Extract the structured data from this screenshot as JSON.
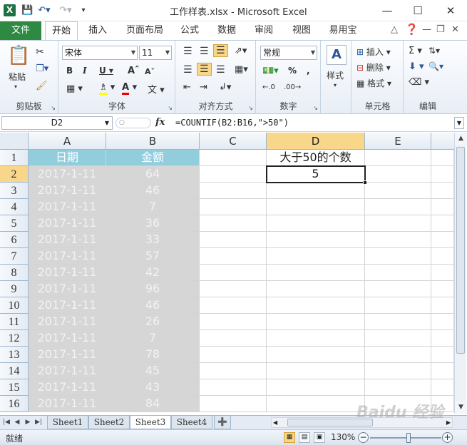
{
  "window": {
    "title": "工作样表.xlsx - Microsoft Excel",
    "logo": "X"
  },
  "ribbon": {
    "file_tab": "文件",
    "tabs": [
      "开始",
      "插入",
      "页面布局",
      "公式",
      "数据",
      "审阅",
      "视图",
      "易用宝"
    ],
    "active_tab": "开始",
    "clipboard": {
      "paste": "粘贴",
      "label": "剪贴板"
    },
    "font": {
      "name": "宋体",
      "size": "11",
      "label": "字体"
    },
    "alignment": {
      "label": "对齐方式"
    },
    "number": {
      "format": "常规",
      "label": "数字"
    },
    "styles": {
      "button": "样式"
    },
    "cells": {
      "insert": "插入",
      "delete": "删除",
      "format": "格式",
      "label": "单元格"
    },
    "editing": {
      "label": "编辑"
    }
  },
  "formula_bar": {
    "name_box": "D2",
    "fx": "fx",
    "formula": "=COUNTIF(B2:B16,\">50\")"
  },
  "sheet": {
    "columns": [
      "A",
      "B",
      "C",
      "D",
      "E"
    ],
    "rows": [
      "1",
      "2",
      "3",
      "4",
      "5",
      "6",
      "7",
      "8",
      "9",
      "10",
      "11",
      "12",
      "13",
      "14",
      "15",
      "16"
    ],
    "header_row": {
      "A": "日期",
      "B": "金额",
      "D": "大于50的个数"
    },
    "data": [
      {
        "A": "2017-1-11",
        "B": "64"
      },
      {
        "A": "2017-1-11",
        "B": "46"
      },
      {
        "A": "2017-1-11",
        "B": "7"
      },
      {
        "A": "2017-1-11",
        "B": "36"
      },
      {
        "A": "2017-1-11",
        "B": "33"
      },
      {
        "A": "2017-1-11",
        "B": "57"
      },
      {
        "A": "2017-1-11",
        "B": "42"
      },
      {
        "A": "2017-1-11",
        "B": "96"
      },
      {
        "A": "2017-1-11",
        "B": "46"
      },
      {
        "A": "2017-1-11",
        "B": "26"
      },
      {
        "A": "2017-1-11",
        "B": "7"
      },
      {
        "A": "2017-1-11",
        "B": "78"
      },
      {
        "A": "2017-1-11",
        "B": "45"
      },
      {
        "A": "2017-1-11",
        "B": "43"
      },
      {
        "A": "2017-1-11",
        "B": "84"
      }
    ],
    "result_cell": {
      "D2": "5"
    },
    "selected_cell": "D2"
  },
  "sheet_tabs": [
    "Sheet1",
    "Sheet2",
    "Sheet3",
    "Sheet4"
  ],
  "active_sheet": "Sheet3",
  "status": {
    "ready": "就绪",
    "zoom": "130%"
  },
  "watermark": "Baidu 经验",
  "colors": {
    "header_fill": "#92cddc",
    "data_fill": "#d6d6d6",
    "file_tab": "#2e8a43",
    "selected_header": "#f9d78a"
  }
}
